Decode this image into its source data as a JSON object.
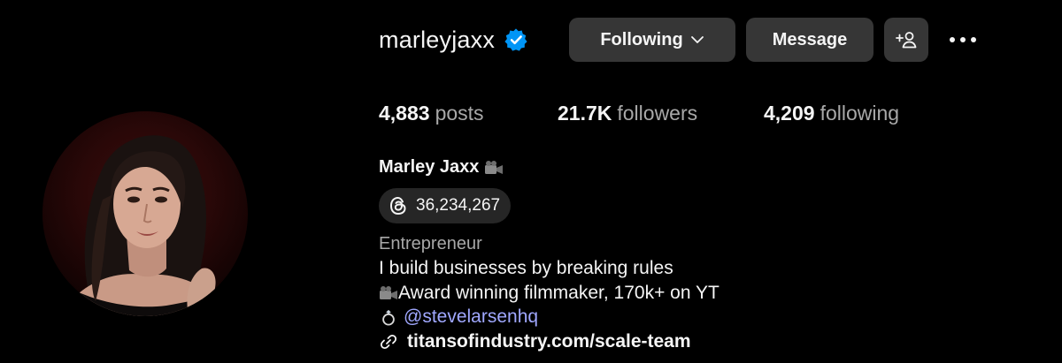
{
  "profile": {
    "username": "marleyjaxx",
    "verified": true,
    "full_name": "Marley Jaxx",
    "full_name_emoji": "movie-camera-icon"
  },
  "actions": {
    "following_label": "Following",
    "message_label": "Message",
    "add_user_icon": "add-user-icon",
    "more_icon": "more-options-icon"
  },
  "stats": {
    "posts_count": "4,883",
    "posts_label": "posts",
    "followers_count": "21.7K",
    "followers_label": "followers",
    "following_count": "4,209",
    "following_label": "following"
  },
  "threads": {
    "icon": "threads-icon",
    "count": "36,234,267"
  },
  "bio": {
    "category": "Entrepreneur",
    "line1": "I build businesses by breaking rules",
    "line2": "Award winning filmmaker, 170k+ on YT",
    "line3_mention": "@stevelarsenhq",
    "link": "titansofindustry.com/scale-team"
  },
  "colors": {
    "background": "#000000",
    "button": "#363636",
    "secondary_text": "#a8a8a8",
    "verified_blue": "#0095f6",
    "mention": "#a0a8ff"
  }
}
